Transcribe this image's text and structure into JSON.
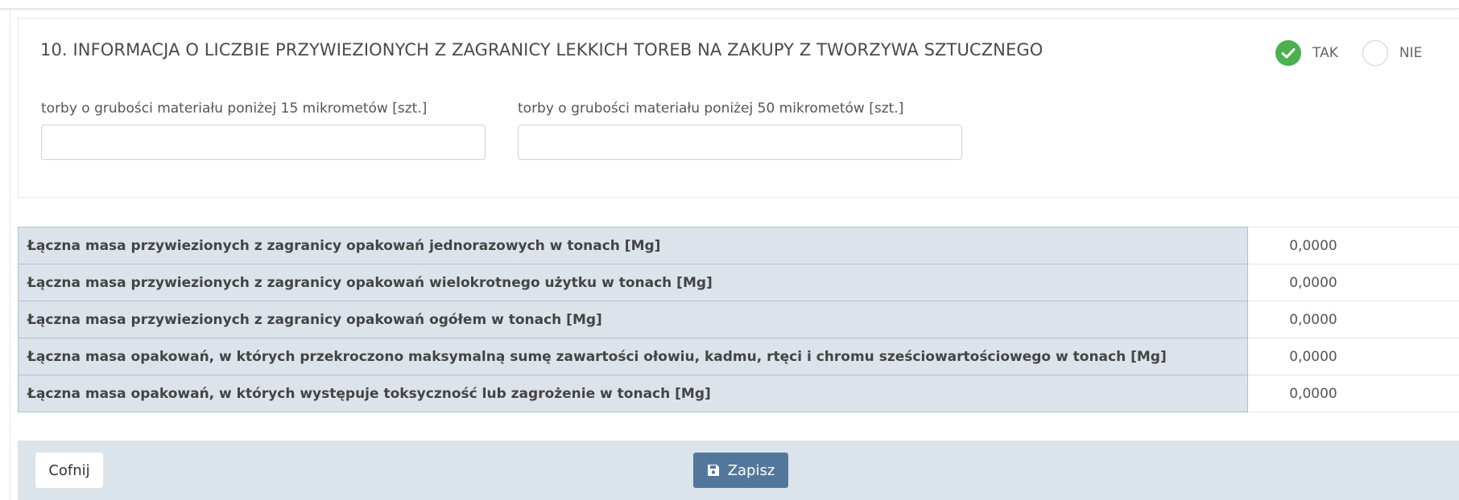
{
  "section": {
    "title": "10. INFORMACJA O LICZBIE PRZYWIEZIONYCH Z ZAGRANICY LEKKICH TOREB NA ZAKUPY Z TWORZYWA SZTUCZNEGO",
    "radio": {
      "yes_label": "TAK",
      "no_label": "NIE",
      "selected": "TAK"
    },
    "fields": [
      {
        "label": "torby o grubości materiału poniżej 15 mikrometów [szt.]",
        "value": ""
      },
      {
        "label": "torby o grubości materiału poniżej 50 mikrometów [szt.]",
        "value": ""
      }
    ]
  },
  "summary": {
    "rows": [
      {
        "label": "Łączna masa przywiezionych z zagranicy opakowań jednorazowych w tonach [Mg]",
        "value": "0,0000"
      },
      {
        "label": "Łączna masa przywiezionych z zagranicy opakowań wielokrotnego użytku w tonach [Mg]",
        "value": "0,0000"
      },
      {
        "label": "Łączna masa przywiezionych z zagranicy opakowań ogółem w tonach [Mg]",
        "value": "0,0000"
      },
      {
        "label": "Łączna masa opakowań, w których przekroczono maksymalną sumę zawartości ołowiu, kadmu, rtęci i chromu sześciowartościowego w tonach [Mg]",
        "value": "0,0000"
      },
      {
        "label": "Łączna masa opakowań, w których występuje toksyczność lub zagrożenie w tonach [Mg]",
        "value": "0,0000"
      }
    ]
  },
  "footer": {
    "back_label": "Cofnij",
    "save_label": "Zapisz",
    "save_icon": "floppy-disk-icon"
  },
  "colors": {
    "checked_radio": "#4caf50",
    "table_label_bg": "#dce3ea",
    "footer_bg": "#dbe3eb",
    "save_button": "#52779a"
  }
}
